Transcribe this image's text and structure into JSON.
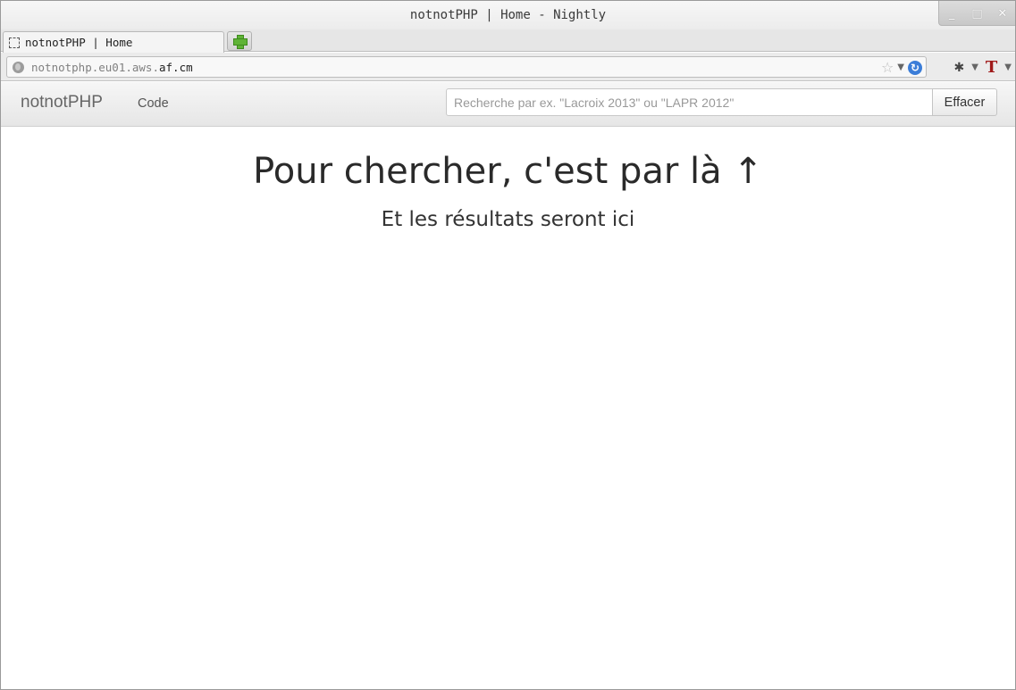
{
  "window": {
    "title": "notnotPHP | Home - Nightly",
    "controls": {
      "minimize": "_",
      "maximize": "□",
      "close": "✕"
    }
  },
  "tabs": [
    {
      "label": "notnotPHP | Home",
      "active": true
    }
  ],
  "new_tab": {
    "icon": "plus-icon"
  },
  "urlbar": {
    "url_prefix": "notnotphp.eu01.aws.",
    "url_host": "af.cm",
    "icons": [
      "globe-icon",
      "star-icon",
      "dropdown-icon",
      "reload-icon"
    ]
  },
  "toolbar_icons": [
    "bug-icon",
    "text-t-icon"
  ],
  "site": {
    "brand": "notnotPHP",
    "nav": {
      "code": "Code"
    },
    "search": {
      "placeholder": "Recherche par ex. \"Lacroix 2013\" ou \"LAPR 2012\"",
      "value": ""
    },
    "clear_button": "Effacer"
  },
  "content": {
    "title": "Pour chercher, c'est par là ↑",
    "subtitle": "Et les résultats seront ici"
  },
  "colors": {
    "accent_reload": "#3b7dd8",
    "newtab_green": "#5fb336",
    "t_icon": "#a01a1a"
  }
}
